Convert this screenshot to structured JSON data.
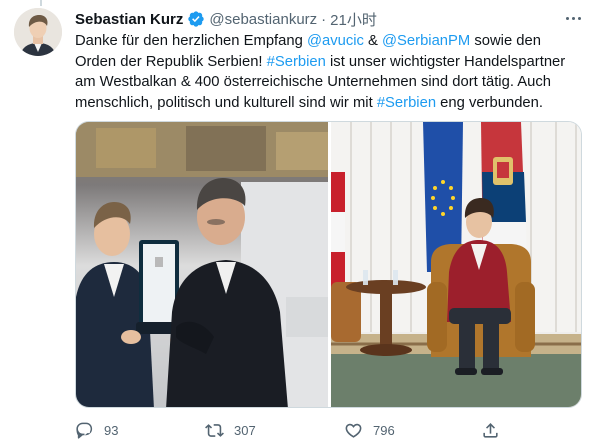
{
  "tweet": {
    "author": {
      "name": "Sebastian Kurz",
      "handle": "@sebastiankurz",
      "verified": true
    },
    "separator": "·",
    "time": "21小时",
    "text_lines": [
      [
        {
          "t": "Danke für den herzlichen Empfang ",
          "link": false
        },
        {
          "t": "@avucic",
          "link": true
        },
        {
          "t": " & ",
          "link": false
        },
        {
          "t": "@SerbianPM",
          "link": true
        },
        {
          "t": " sowie den",
          "link": false
        }
      ],
      [
        {
          "t": "Orden der Republik Serbien! ",
          "link": false
        },
        {
          "t": "#Serbien",
          "link": true
        },
        {
          "t": " ist unser wichtigster Handelspartner",
          "link": false
        }
      ],
      [
        {
          "t": "am Westbalkan & 400 österreichische Unternehmen sind dort tätig. Auch",
          "link": false
        }
      ],
      [
        {
          "t": "menschlich, politisch und kulturell sind wir mit ",
          "link": false
        },
        {
          "t": "#Serbien",
          "link": true
        },
        {
          "t": " eng verbunden.",
          "link": false
        }
      ]
    ],
    "media": [
      {
        "kind": "photo",
        "subject": "award-ceremony"
      },
      {
        "kind": "photo",
        "subject": "meeting-room"
      }
    ],
    "actions": {
      "reply_count": "93",
      "retweet_count": "307",
      "like_count": "796",
      "share_count": ""
    }
  },
  "colors": {
    "link": "#1d9bf0",
    "secondary_text": "#536471",
    "border": "#cfd9de",
    "verified_badge": "#1d9bf0"
  },
  "icons": {
    "verified": "verified-badge-icon",
    "more": "more-horizontal-icon",
    "reply": "reply-icon",
    "retweet": "retweet-icon",
    "like": "heart-icon",
    "share": "share-icon"
  }
}
